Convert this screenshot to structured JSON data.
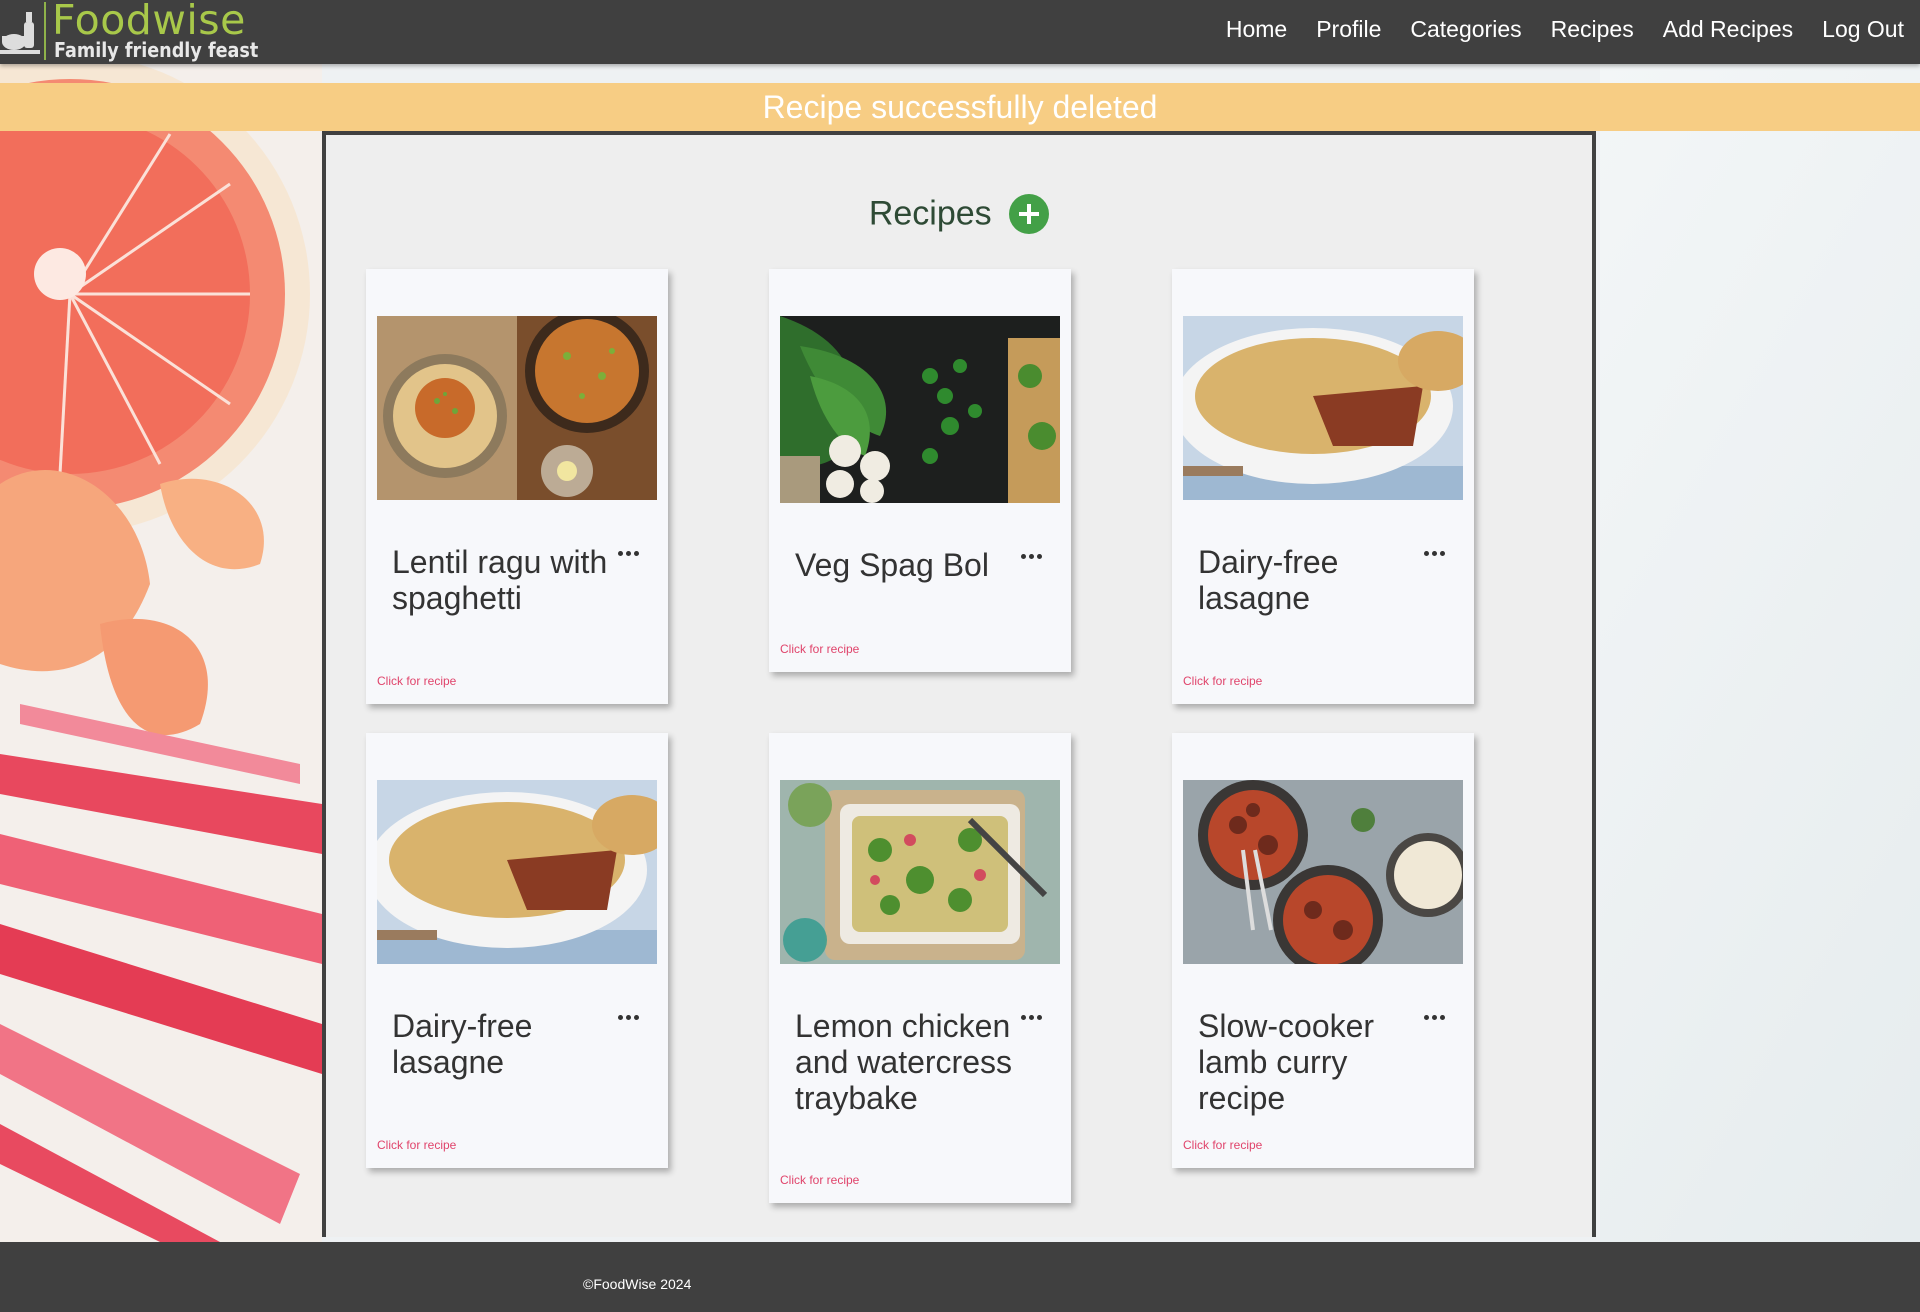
{
  "header": {
    "logo_title": "Foodwise",
    "logo_subtitle": "Family friendly feast",
    "nav": [
      "Home",
      "Profile",
      "Categories",
      "Recipes",
      "Add Recipes",
      "Log Out"
    ]
  },
  "alert": {
    "message": "Recipe successfully deleted"
  },
  "main": {
    "title": "Recipes",
    "link_label": "Click for recipe",
    "recipes": [
      {
        "title": "Lentil ragu with spaghetti",
        "image": "lentil-ragu-image"
      },
      {
        "title": "Veg Spag Bol",
        "image": "herbs-garlic-image"
      },
      {
        "title": "Dairy-free lasagne",
        "image": "lasagne-image"
      },
      {
        "title": "Dairy-free lasagne",
        "image": "lasagne-image"
      },
      {
        "title": "Lemon chicken and watercress traybake",
        "image": "traybake-image"
      },
      {
        "title": "Slow-cooker lamb curry recipe",
        "image": "lamb-curry-image"
      }
    ]
  },
  "footer": {
    "copyright": "©FoodWise 2024"
  },
  "colors": {
    "header_bg": "#404040",
    "alert_bg": "#f7cd84",
    "accent_green": "#43a047",
    "link_pink": "#e0446b",
    "panel_bg": "#eeeeee"
  }
}
